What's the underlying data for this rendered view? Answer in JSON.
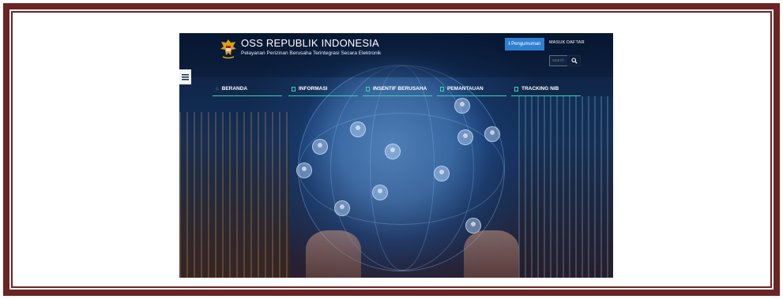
{
  "header": {
    "title": "OSS REPUBLIK INDONESIA",
    "subtitle": "Pelayanan Perizinan Berusaha Terintegrasi Secara Elektronik",
    "pengumuman_label": "Pengumuman",
    "masuk_label": "MASUK",
    "daftar_label": "DAFTAR",
    "search_placeholder": "search"
  },
  "nav": {
    "items": [
      {
        "label": "BERANDA",
        "icon": "home-icon"
      },
      {
        "label": "INFORMASI",
        "icon": "document-icon"
      },
      {
        "label": "INSENTIF BERUSAHA",
        "icon": "document-icon"
      },
      {
        "label": "PEMANTAUAN",
        "icon": "document-icon"
      },
      {
        "label": "TRACKING NIB",
        "icon": "document-icon"
      }
    ]
  },
  "colors": {
    "frame": "#6b2424",
    "accent": "#3fd3b4",
    "button": "#2f7fd1"
  }
}
